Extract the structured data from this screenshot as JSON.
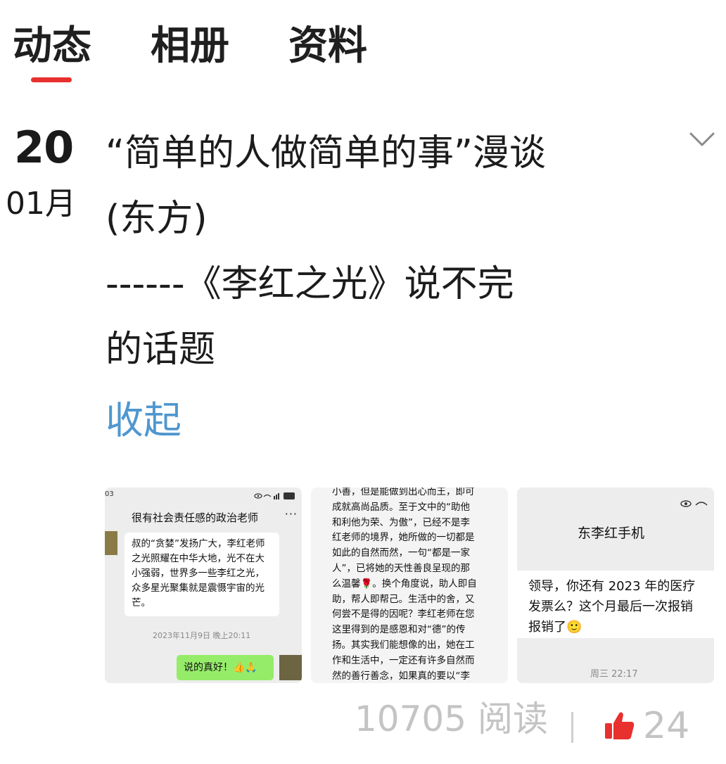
{
  "tabs": [
    {
      "label": "动态",
      "active": true
    },
    {
      "label": "相册",
      "active": false
    },
    {
      "label": "资料",
      "active": false
    }
  ],
  "accent_color": "#e8302e",
  "link_color": "#4f97cf",
  "post": {
    "date_day": "20",
    "date_month": "01月",
    "title": "“简单的人做简单的事”漫谈\n(东方)\n------《李红之光》说不完\n的话题",
    "collapse_label": "收起",
    "expand_icon": "chevron-down-icon"
  },
  "thumbnails": {
    "chat1": {
      "status_time": "03",
      "header": "很有社会责任感的政治老师",
      "more": "···",
      "message": "叔的“贪婪”发扬广大，李红老师之光照耀在中华大地，光不在大小强弱，世界多一些李红之光，众多星光聚集就是震慑宇宙的光芒。",
      "time": "2023年11月9日 晚上20:11",
      "reply": "说的真好！👍🙏"
    },
    "article": {
      "text": "小善，但是能做到出心而王，即可\n成就高尚品质。至于文中的“助他\n和利他为荣、为傲”，已经不是李\n红老师的境界，她所做的一切都是\n如此的自然而然，一句“都是一家\n人”，已将她的天性善良呈现的那\n么温馨🌹。换个角度说，助人即自\n助，帮人即帮己。生活中的舍，又\n何尝不是得的因呢？李红老师在您\n这里得到的是感恩和对“德”的传\n扬。其实我们能想像的出，她在工\n作和生活中，一定还有许多自然而\n然的善行善念，如果真的要以“李\n红之光”作为善行善念的传扬之平\n台，首先在征求李红老师的同意之\n后，可以把集整理她以及更多普通"
    },
    "chat2": {
      "title": "东李红手机",
      "message": "领导，你还有 2023 年的医疗\n发票么？这个月最后一次报销\n报销了🙂",
      "time": "周三 22:17"
    }
  },
  "footer": {
    "read_count": "10705 阅读",
    "like_count": "24",
    "like_icon": "thumbs-up-icon",
    "like_color": "#e8302e"
  }
}
